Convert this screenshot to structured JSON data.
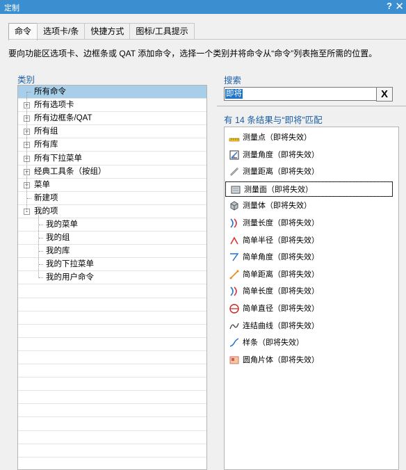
{
  "window": {
    "title": "定制",
    "help": "?",
    "close": "✕"
  },
  "tabs": [
    {
      "label": "命令",
      "active": true
    },
    {
      "label": "选项卡/条"
    },
    {
      "label": "快捷方式"
    },
    {
      "label": "图标/工具提示"
    }
  ],
  "instruction": "要向功能区选项卡、边框条或 QAT 添加命令，选择一个类别并将命令从“命令”列表拖至所需的位置。",
  "categories": {
    "label": "类别",
    "items": [
      {
        "label": "所有命令",
        "expander": "",
        "level": 0,
        "selected": true
      },
      {
        "label": "所有选项卡",
        "expander": "+",
        "level": 0
      },
      {
        "label": "所有边框条/QAT",
        "expander": "+",
        "level": 0
      },
      {
        "label": "所有组",
        "expander": "+",
        "level": 0
      },
      {
        "label": "所有库",
        "expander": "+",
        "level": 0
      },
      {
        "label": "所有下拉菜单",
        "expander": "+",
        "level": 0
      },
      {
        "label": "经典工具条（按组）",
        "expander": "+",
        "level": 0
      },
      {
        "label": "菜单",
        "expander": "+",
        "level": 0
      },
      {
        "label": "新建项",
        "expander": "",
        "level": 0
      },
      {
        "label": "我的项",
        "expander": "-",
        "level": 0
      },
      {
        "label": "我的菜单",
        "expander": "",
        "level": 1
      },
      {
        "label": "我的组",
        "expander": "",
        "level": 1
      },
      {
        "label": "我的库",
        "expander": "",
        "level": 1
      },
      {
        "label": "我的下拉菜单",
        "expander": "",
        "level": 1
      },
      {
        "label": "我的用户命令",
        "expander": "",
        "level": 1
      }
    ]
  },
  "search": {
    "label": "搜索",
    "value": "即将",
    "clear_label": "X"
  },
  "results": {
    "summary": "有 14 条结果与“即将”匹配",
    "items": [
      {
        "label": "测量点（即将失效）",
        "icon": "ruler-point-icon"
      },
      {
        "label": "测量角度（即将失效）",
        "icon": "measure-angle-icon"
      },
      {
        "label": "测量距离（即将失效）",
        "icon": "measure-distance-icon"
      },
      {
        "label": "测量面（即将失效）",
        "icon": "measure-face-icon",
        "focused": true
      },
      {
        "label": "测量体（即将失效）",
        "icon": "measure-body-icon"
      },
      {
        "label": "测量长度（即将失效）",
        "icon": "measure-length-icon"
      },
      {
        "label": "简单半径（即将失效）",
        "icon": "simple-radius-icon"
      },
      {
        "label": "简单角度（即将失效）",
        "icon": "simple-angle-icon"
      },
      {
        "label": "简单距离（即将失效）",
        "icon": "simple-distance-icon"
      },
      {
        "label": "简单长度（即将失效）",
        "icon": "simple-length-icon"
      },
      {
        "label": "简单直径（即将失效）",
        "icon": "simple-diameter-icon"
      },
      {
        "label": "连结曲线（即将失效）",
        "icon": "join-curve-icon"
      },
      {
        "label": "样条（即将失效）",
        "icon": "spline-icon"
      },
      {
        "label": "圆角片体（即将失效）",
        "icon": "fillet-sheet-icon"
      }
    ]
  },
  "colors": {
    "titlebar": "#3b8fd0",
    "section_label": "#1b5fa6",
    "selection": "#a8cfea",
    "search_highlight": "#1e74c8"
  }
}
